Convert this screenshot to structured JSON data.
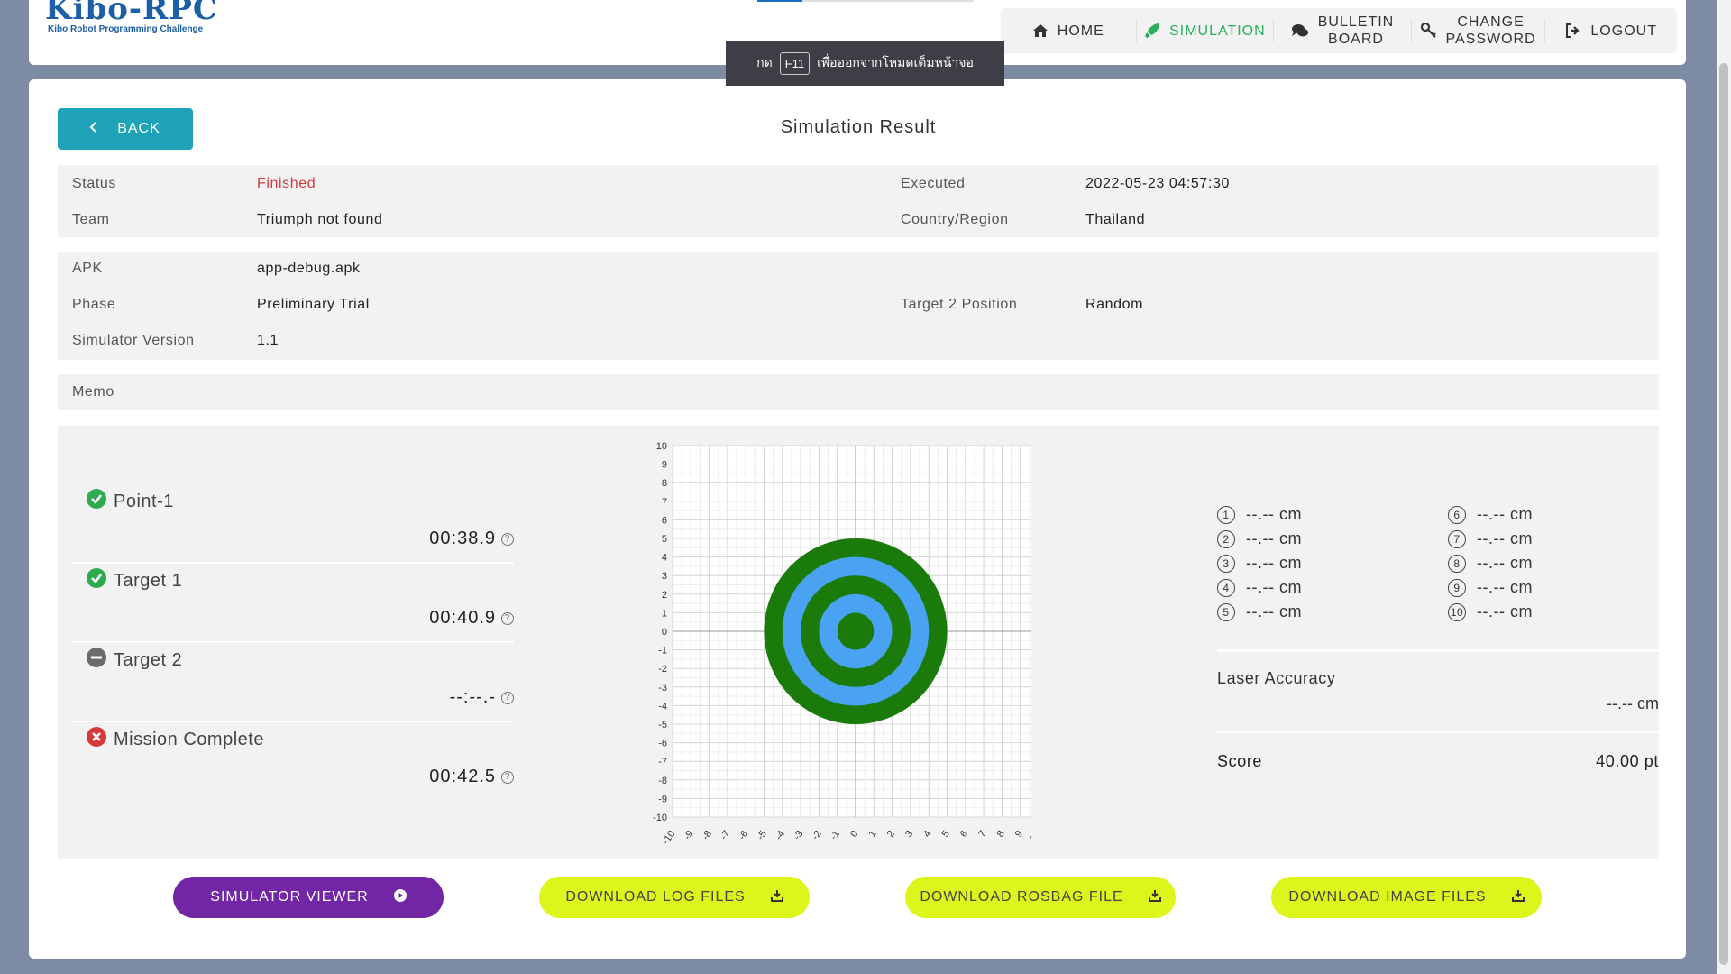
{
  "header": {
    "logo_main": "Kibo-RPC",
    "logo_sub": "Kibo Robot Programming Challenge",
    "nav": [
      {
        "label": "HOME",
        "icon": "home-icon"
      },
      {
        "label": "SIMULATION",
        "icon": "rocket-icon",
        "active": true
      },
      {
        "label_line1": "BULLETIN",
        "label_line2": "BOARD",
        "icon": "comments-icon"
      },
      {
        "label_line1": "CHANGE",
        "label_line2": "PASSWORD",
        "icon": "key-icon"
      },
      {
        "label": "LOGOUT",
        "icon": "logout-icon"
      }
    ]
  },
  "toast": {
    "prefix": "กด",
    "key": "F11",
    "suffix": "เพื่อออกจากโหมดเต็มหน้าจอ"
  },
  "page": {
    "back_label": "BACK",
    "title": "Simulation Result"
  },
  "info": {
    "status_label": "Status",
    "status_value": "Finished",
    "executed_label": "Executed",
    "executed_value": "2022-05-23 04:57:30",
    "team_label": "Team",
    "team_value": "Triumph not found",
    "country_label": "Country/Region",
    "country_value": "Thailand",
    "apk_label": "APK",
    "apk_value": "app-debug.apk",
    "phase_label": "Phase",
    "phase_value": "Preliminary Trial",
    "target2_label": "Target 2 Position",
    "target2_value": "Random",
    "simver_label": "Simulator Version",
    "simver_value": "1.1",
    "memo_label": "Memo"
  },
  "milestones": [
    {
      "name": "Point-1",
      "time": "00:38.9",
      "state": "check"
    },
    {
      "name": "Target 1",
      "time": "00:40.9",
      "state": "check"
    },
    {
      "name": "Target 2",
      "time": "--:--.-",
      "state": "minus"
    },
    {
      "name": "Mission Complete",
      "time": "00:42.5",
      "state": "cross"
    }
  ],
  "distances": [
    {
      "n": "1",
      "value": "--.-- cm"
    },
    {
      "n": "2",
      "value": "--.-- cm"
    },
    {
      "n": "3",
      "value": "--.-- cm"
    },
    {
      "n": "4",
      "value": "--.-- cm"
    },
    {
      "n": "5",
      "value": "--.-- cm"
    },
    {
      "n": "6",
      "value": "--.-- cm"
    },
    {
      "n": "7",
      "value": "--.-- cm"
    },
    {
      "n": "8",
      "value": "--.-- cm"
    },
    {
      "n": "9",
      "value": "--.-- cm"
    },
    {
      "n": "10",
      "value": "--.-- cm"
    }
  ],
  "laser": {
    "label": "Laser Accuracy",
    "value": "--.-- cm"
  },
  "score": {
    "label": "Score",
    "value": "40.00 pt"
  },
  "buttons": {
    "viewer": "SIMULATOR VIEWER",
    "log": "DOWNLOAD LOG FILES",
    "rosbag": "DOWNLOAD ROSBAG FILE",
    "image": "DOWNLOAD IMAGE FILES"
  },
  "target_chart": {
    "axis_min": -10,
    "axis_max": 10,
    "ring_colors": [
      "#1a7a0a",
      "#4aa3f2",
      "#1a7a0a",
      "#4aa3f2",
      "#1a7a0a"
    ],
    "ring_radii_units": [
      5,
      4,
      3,
      2,
      1
    ]
  },
  "colors": {
    "accent": "#1fa3b8",
    "active_nav": "#29b05a",
    "status_red": "#d43a3a",
    "viewer_purple": "#7226a6",
    "download_lime": "#dcf51b"
  }
}
